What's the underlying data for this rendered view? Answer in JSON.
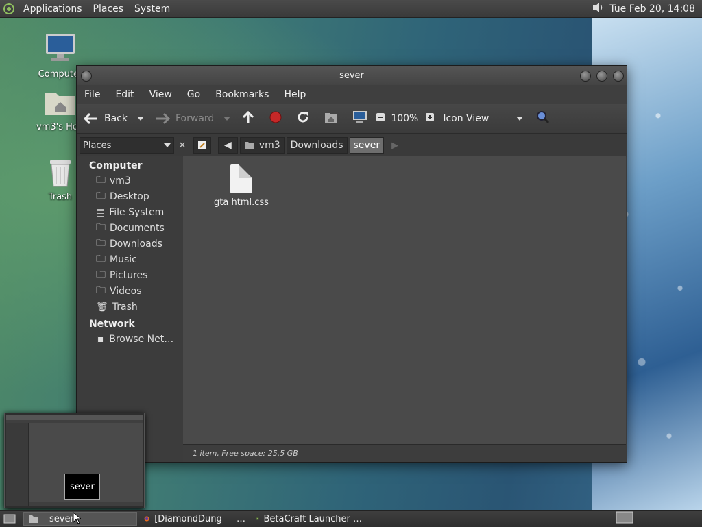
{
  "top_panel": {
    "menus": [
      "Applications",
      "Places",
      "System"
    ],
    "clock": "Tue Feb 20, 14:08",
    "volume_icon": "volume-icon",
    "logo_icon": "app-menu-logo-icon"
  },
  "desktop_icons": [
    {
      "label": "Computer",
      "icon": "computer-icon"
    },
    {
      "label": "vm3's Home",
      "icon": "home-folder-icon"
    },
    {
      "label": "Trash",
      "icon": "trash-icon"
    }
  ],
  "window": {
    "title": "sever",
    "menubar": [
      "File",
      "Edit",
      "View",
      "Go",
      "Bookmarks",
      "Help"
    ],
    "toolbar": {
      "back_label": "Back",
      "forward_label": "Forward",
      "zoom": "100%",
      "view_mode": "Icon View"
    },
    "sidebar": {
      "combo_label": "Places",
      "sections": [
        {
          "heading": "Computer",
          "items": [
            "vm3",
            "Desktop",
            "File System",
            "Documents",
            "Downloads",
            "Music",
            "Pictures",
            "Videos",
            "Trash"
          ]
        },
        {
          "heading": "Network",
          "items": [
            "Browse Net…"
          ]
        }
      ]
    },
    "breadcrumbs": [
      "vm3",
      "Downloads",
      "sever"
    ],
    "files": [
      {
        "name": "gta html.css",
        "icon": "text-file-icon"
      }
    ],
    "status": "1 item, Free space: 25.5 GB"
  },
  "thumbnail": {
    "tooltip": "sever"
  },
  "taskbar": {
    "tasks": [
      "sever",
      "[DiamondDung — …",
      "BetaCraft Launcher …"
    ]
  },
  "colors": {
    "panel": "#3a3a3a",
    "window_bg": "#3c3c3c",
    "content_bg": "#4a4a4a",
    "active_crumb": "#6e6e6e"
  }
}
